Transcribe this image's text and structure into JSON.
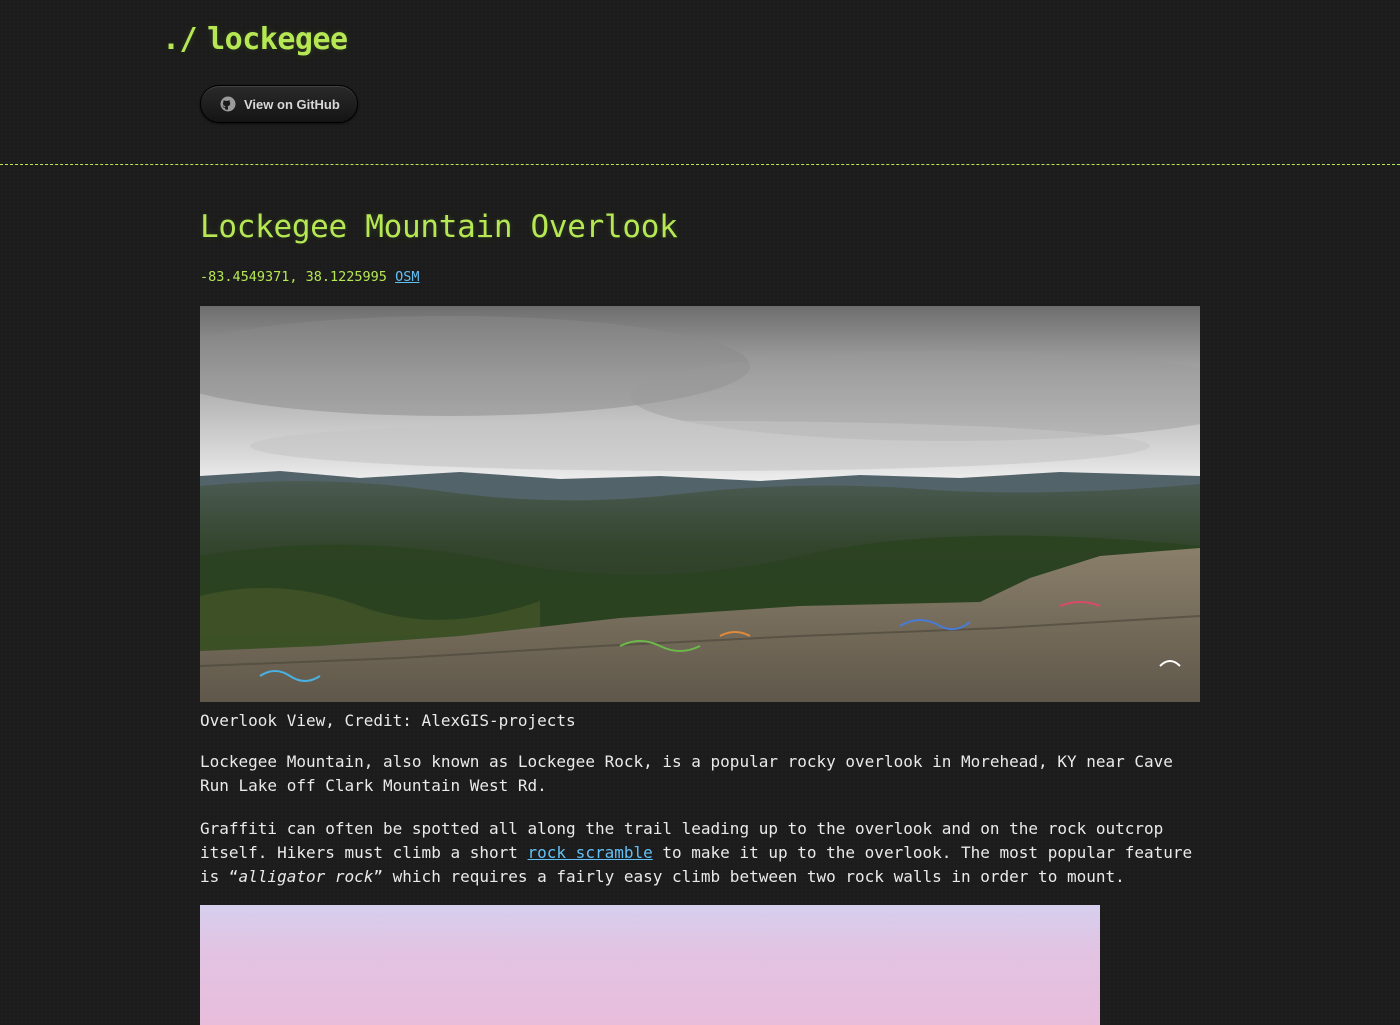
{
  "header": {
    "title_prefix": "./",
    "title": "lockegee",
    "github_button_label": "View on GitHub"
  },
  "post": {
    "title": "Lockegee Mountain Overlook",
    "coordinates": "-83.4549371, 38.1225995",
    "osm_link": "OSM",
    "caption": "Overlook View, Credit: AlexGIS-projects",
    "para1": "Lockegee Mountain, also known as Lockegee Rock, is a popular rocky overlook in Morehead, KY near Cave Run Lake off Clark Mountain West Rd.",
    "para2_part1": "Graffiti can often be spotted all along the trail leading up to the overlook and on the rock outcrop itself. Hikers must climb a short ",
    "para2_link": "rock scramble",
    "para2_part2": " to make it up to the overlook. The most popular feature is “",
    "para2_em": "alligator rock",
    "para2_part3": "” which requires a fairly easy climb between two rock walls in order to mount."
  },
  "colors": {
    "accent": "#b5e853",
    "link": "#63c0f5",
    "background": "#1c1c1c",
    "text": "#eaeaea"
  },
  "icons": {
    "github": "github-icon"
  }
}
